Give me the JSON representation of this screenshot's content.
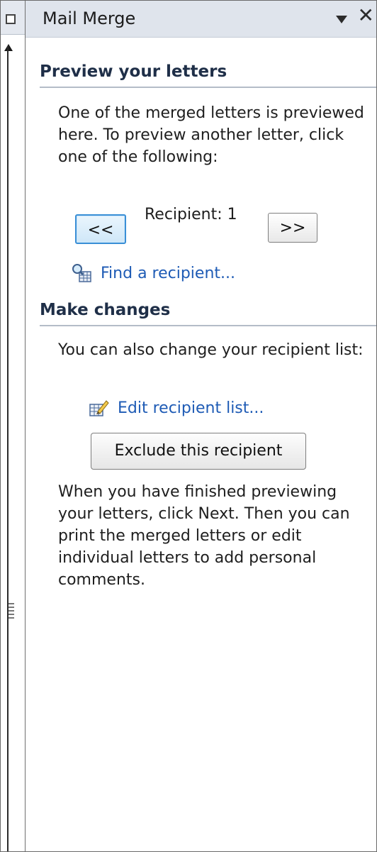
{
  "pane": {
    "title": "Mail Merge",
    "close_glyph": "✕"
  },
  "preview": {
    "heading": "Preview your letters",
    "description": "One of the merged letters is previewed here. To preview another letter, click one of the following:",
    "prev_label": "<<",
    "next_label": ">>",
    "recipient_label": "Recipient: 1",
    "find_link": "Find a recipient..."
  },
  "changes": {
    "heading": "Make changes",
    "description": "You can also change your recipient list:",
    "edit_link": "Edit recipient list...",
    "exclude_label": "Exclude this recipient",
    "finish_text": "When you have finished previewing your letters, click Next. Then you can print the merged letters or edit individual letters to add personal comments."
  },
  "icons": {
    "find": "find-recipient-icon",
    "edit": "edit-list-icon",
    "menu": "pane-menu-arrow-icon",
    "close": "close-icon"
  },
  "colors": {
    "link": "#1e5bb5",
    "heading": "#1f2f48",
    "header_bg": "#dfe4ec",
    "focus": "#3a8fd6"
  }
}
